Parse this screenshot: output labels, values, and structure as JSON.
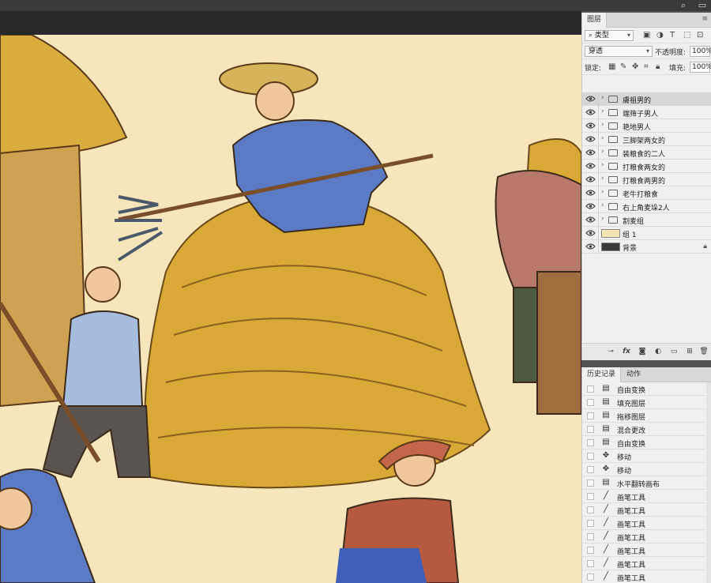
{
  "layers_panel": {
    "tab": "图层",
    "filter_kind": "类型",
    "blend_mode": "穿透",
    "opacity_label": "不透明度:",
    "opacity_value": "100%",
    "lock_label": "锁定:",
    "fill_label": "填充:",
    "fill_value": "100%",
    "layers": [
      {
        "name": "膚祖男的",
        "type": "group",
        "selected": true
      },
      {
        "name": "端筛子男人",
        "type": "group"
      },
      {
        "name": "艳地男人",
        "type": "group"
      },
      {
        "name": "三脚架两女的",
        "type": "group"
      },
      {
        "name": "装粮食的二人",
        "type": "group"
      },
      {
        "name": "打粮食两女的",
        "type": "group"
      },
      {
        "name": "打粮食两男的",
        "type": "group"
      },
      {
        "name": "老牛打粮食",
        "type": "group"
      },
      {
        "name": "右上角麦垛2人",
        "type": "group"
      },
      {
        "name": "割麦组",
        "type": "group"
      },
      {
        "name": "组 1",
        "type": "layer",
        "thumb_color": "#f5e7b4"
      },
      {
        "name": "背景",
        "type": "layer",
        "thumb_color": "#3a3a3a",
        "locked": true
      }
    ]
  },
  "history_panel": {
    "tabs": [
      "历史记录",
      "动作"
    ],
    "items": [
      {
        "name": "自由变换",
        "icon": "doc-icon"
      },
      {
        "name": "填充图层",
        "icon": "doc-icon"
      },
      {
        "name": "拖移图层",
        "icon": "doc-icon"
      },
      {
        "name": "混合更改",
        "icon": "doc-icon"
      },
      {
        "name": "自由变换",
        "icon": "doc-icon"
      },
      {
        "name": "移动",
        "icon": "move-icon"
      },
      {
        "name": "移动",
        "icon": "move-icon"
      },
      {
        "name": "水平翻转画布",
        "icon": "doc-icon"
      },
      {
        "name": "画笔工具",
        "icon": "brush-icon"
      },
      {
        "name": "画笔工具",
        "icon": "brush-icon"
      },
      {
        "name": "画笔工具",
        "icon": "brush-icon"
      },
      {
        "name": "画笔工具",
        "icon": "brush-icon"
      },
      {
        "name": "画笔工具",
        "icon": "brush-icon"
      },
      {
        "name": "画笔工具",
        "icon": "brush-icon"
      },
      {
        "name": "画笔工具",
        "icon": "brush-icon"
      }
    ]
  },
  "colors": {
    "canvas_bg": "#f7e6bb",
    "straw": "#d9ad3a",
    "shirt_blue": "#5a7ac4",
    "panel_bg": "#f0f0f0"
  }
}
